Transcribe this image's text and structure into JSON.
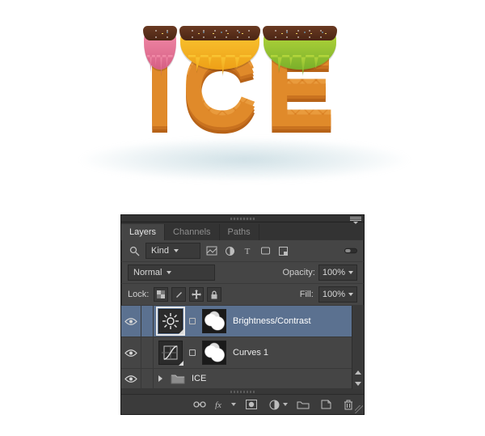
{
  "artwork": {
    "letters": [
      "I",
      "C",
      "E"
    ]
  },
  "panel": {
    "tabs": [
      {
        "label": "Layers",
        "active": true
      },
      {
        "label": "Channels",
        "active": false
      },
      {
        "label": "Paths",
        "active": false
      }
    ],
    "filter": {
      "kind_value": "Kind",
      "icons": [
        "pixel",
        "adjustment",
        "type",
        "shape",
        "smartobject"
      ]
    },
    "blend": {
      "mode_value": "Normal",
      "opacity_label": "Opacity:",
      "opacity_value": "100%"
    },
    "lock": {
      "label": "Lock:",
      "icons": [
        "transparent",
        "paint",
        "move",
        "all"
      ],
      "fill_label": "Fill:",
      "fill_value": "100%"
    },
    "layers": [
      {
        "visible": true,
        "thumb": "brightness-contrast",
        "mask": true,
        "name": "Brightness/Contrast",
        "selected": true
      },
      {
        "visible": true,
        "thumb": "curves",
        "mask": true,
        "name": "Curves 1",
        "selected": false
      },
      {
        "visible": true,
        "thumb": "folder",
        "mask": false,
        "name": "ICE",
        "selected": false,
        "group": true
      }
    ],
    "bottom_icons": [
      "link",
      "fx",
      "layer-mask",
      "adjustment-layer",
      "group",
      "new-layer",
      "trash"
    ]
  }
}
